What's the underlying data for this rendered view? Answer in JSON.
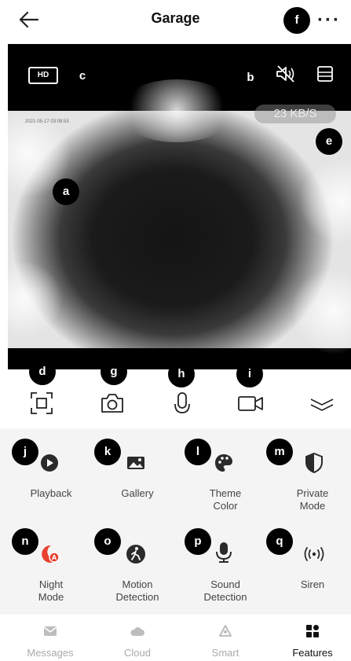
{
  "header": {
    "title": "Garage"
  },
  "video": {
    "quality_label": "HD",
    "osd_timestamp": "2021-05-17 03:08:53",
    "speed": "23 KB/S"
  },
  "markers": [
    "a",
    "b",
    "c",
    "d",
    "e",
    "f",
    "g",
    "h",
    "i",
    "j",
    "k",
    "l",
    "m",
    "n",
    "o",
    "p",
    "q"
  ],
  "features": [
    {
      "label": "Playback",
      "icon": "play-icon"
    },
    {
      "label": "Gallery",
      "icon": "gallery-icon"
    },
    {
      "label": "Theme\nColor",
      "icon": "palette-icon"
    },
    {
      "label": "Private\nMode",
      "icon": "private-shield-icon"
    },
    {
      "label": "Night\nMode",
      "icon": "night-mode-icon"
    },
    {
      "label": "Motion\nDetection",
      "icon": "motion-detection-icon"
    },
    {
      "label": "Sound\nDetection",
      "icon": "sound-detection-icon"
    },
    {
      "label": "Siren",
      "icon": "siren-icon"
    }
  ],
  "bottom_nav": [
    {
      "label": "Messages",
      "icon": "messages-icon",
      "active": false
    },
    {
      "label": "Cloud",
      "icon": "cloud-icon",
      "active": false
    },
    {
      "label": "Smart",
      "icon": "smart-icon",
      "active": false
    },
    {
      "label": "Features",
      "icon": "features-icon",
      "active": true
    }
  ],
  "colors": {
    "accent_red": "#e8412f",
    "icon_dark": "#2b2b2b",
    "inactive": "#aaaaaa"
  }
}
